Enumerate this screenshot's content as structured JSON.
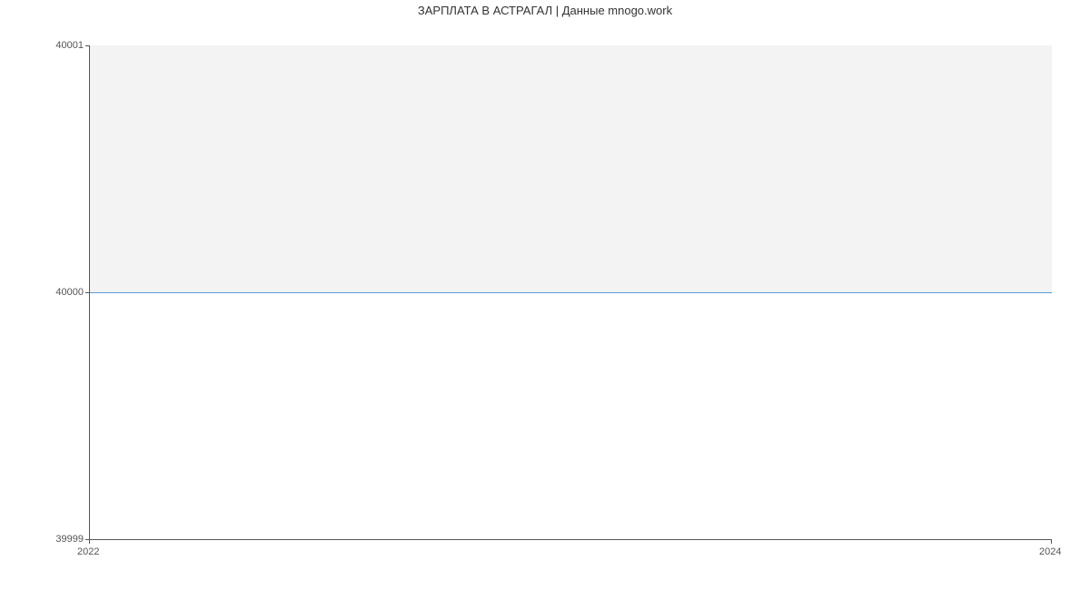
{
  "chart_data": {
    "type": "line",
    "title": "ЗАРПЛАТА В АСТРАГАЛ | Данные mnogo.work",
    "xlabel": "",
    "ylabel": "",
    "x": [
      2022,
      2024
    ],
    "values": [
      40000,
      40000
    ],
    "ylim": [
      39999,
      40001
    ],
    "xlim": [
      2022,
      2024
    ],
    "y_ticks": [
      {
        "label": "40001",
        "value": 40001
      },
      {
        "label": "40000",
        "value": 40000
      },
      {
        "label": "39999",
        "value": 39999
      }
    ],
    "x_ticks": [
      {
        "label": "2022",
        "value": 2022
      },
      {
        "label": "2024",
        "value": 2024
      }
    ]
  }
}
